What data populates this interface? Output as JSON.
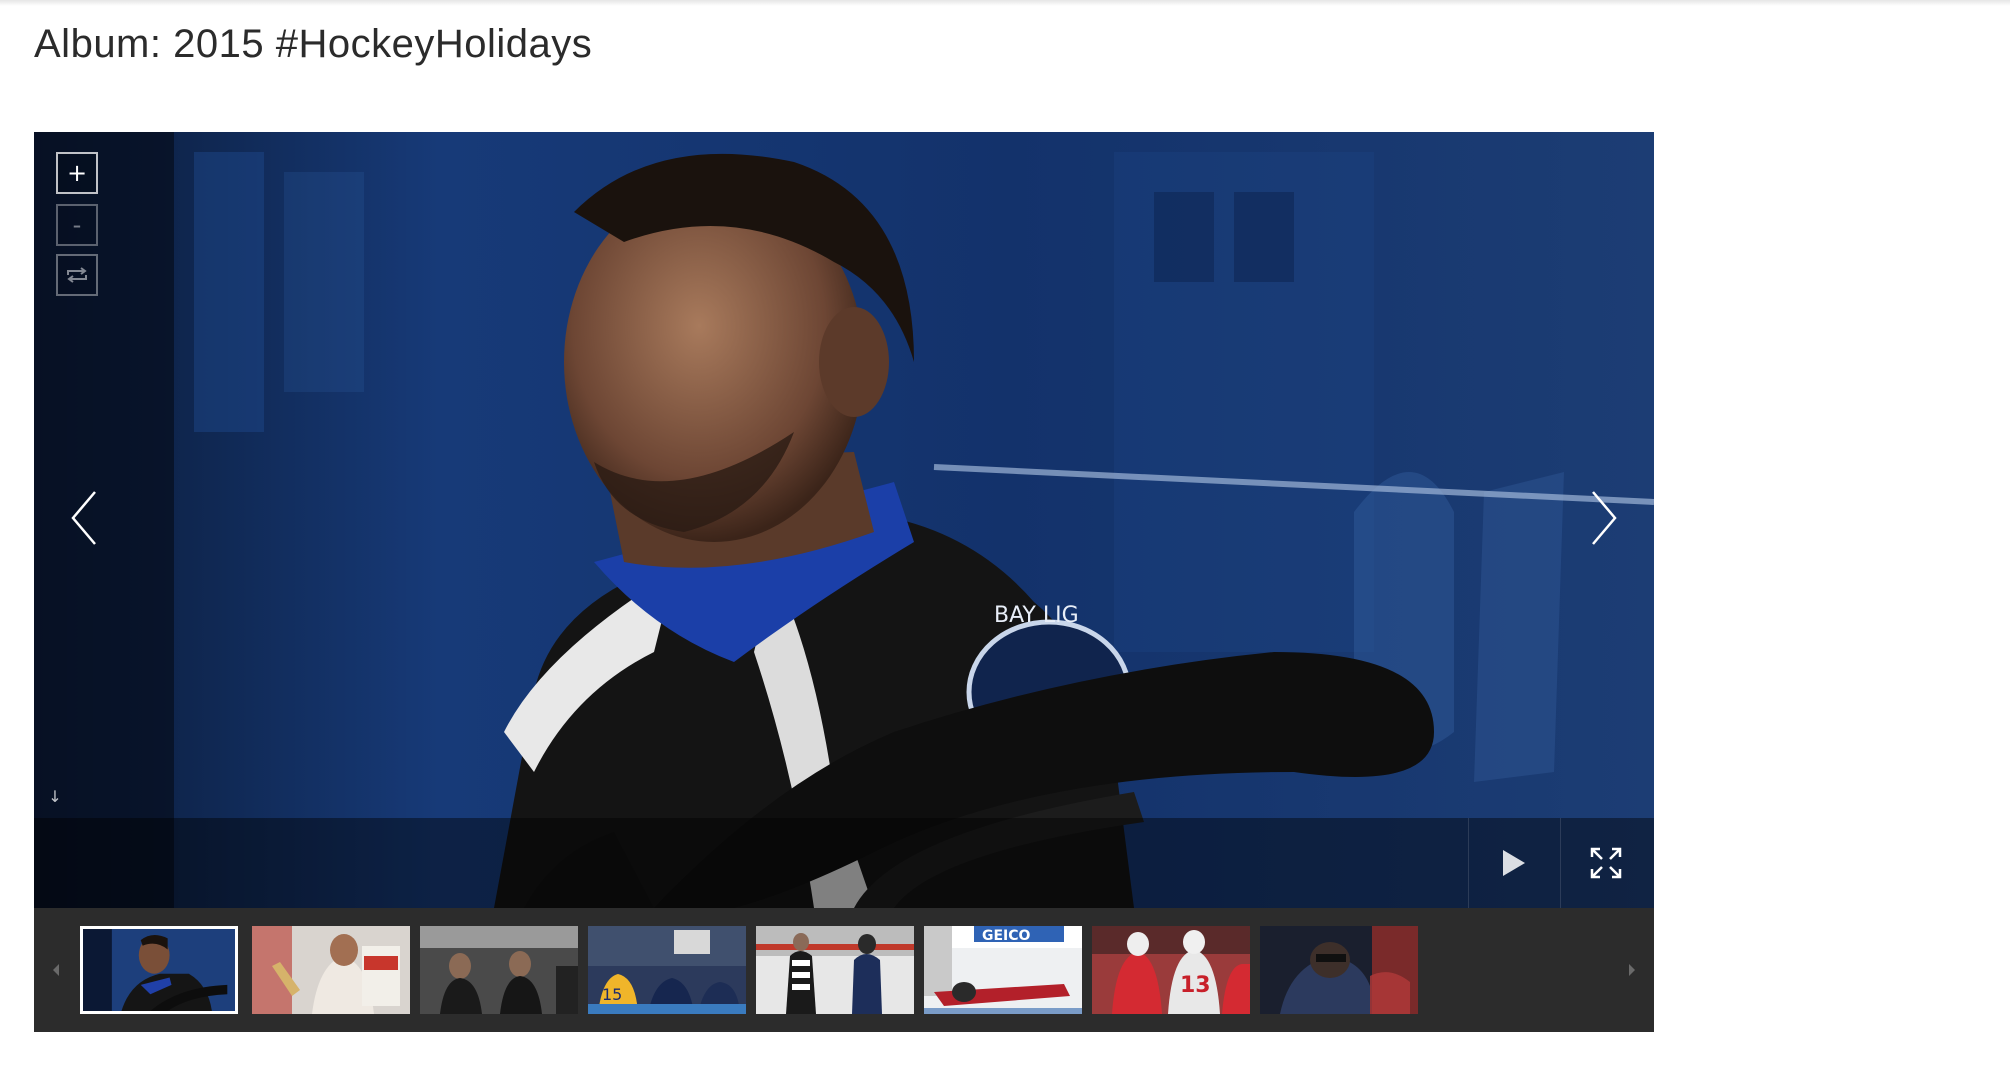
{
  "album": {
    "title": "Album: 2015 #HockeyHolidays"
  },
  "viewer": {
    "zoom_in_label": "+",
    "zoom_out_label": "-",
    "rotate_icon": "rotate-icon",
    "download_icon": "download-arrow-icon",
    "prev_icon": "chevron-left-icon",
    "next_icon": "chevron-right-icon",
    "play_icon": "play-icon",
    "fullscreen_icon": "fullscreen-icon",
    "jersey_patch_text": "BAY LIG"
  },
  "thumbnails": [
    {
      "name": "thumb-player-bench",
      "active": true,
      "jersey_number": ""
    },
    {
      "name": "thumb-goalie-celebration",
      "active": false,
      "jersey_number": ""
    },
    {
      "name": "thumb-players-bench-row",
      "active": false,
      "jersey_number": ""
    },
    {
      "name": "thumb-crowd-sign",
      "active": false,
      "jersey_number": "15"
    },
    {
      "name": "thumb-referee-skater",
      "active": false,
      "jersey_number": ""
    },
    {
      "name": "thumb-player-on-ice",
      "active": false,
      "jersey_number": ""
    },
    {
      "name": "thumb-red-wings-players",
      "active": false,
      "jersey_number": "13"
    },
    {
      "name": "thumb-dark-closeup",
      "active": false,
      "jersey_number": ""
    }
  ],
  "thumbnail_board_text": "GEICO",
  "colors": {
    "page_background": "#ffffff",
    "title_text": "#2b2b2b",
    "strip_background": "#2c2c2c",
    "active_thumb_border": "#ffffff"
  }
}
